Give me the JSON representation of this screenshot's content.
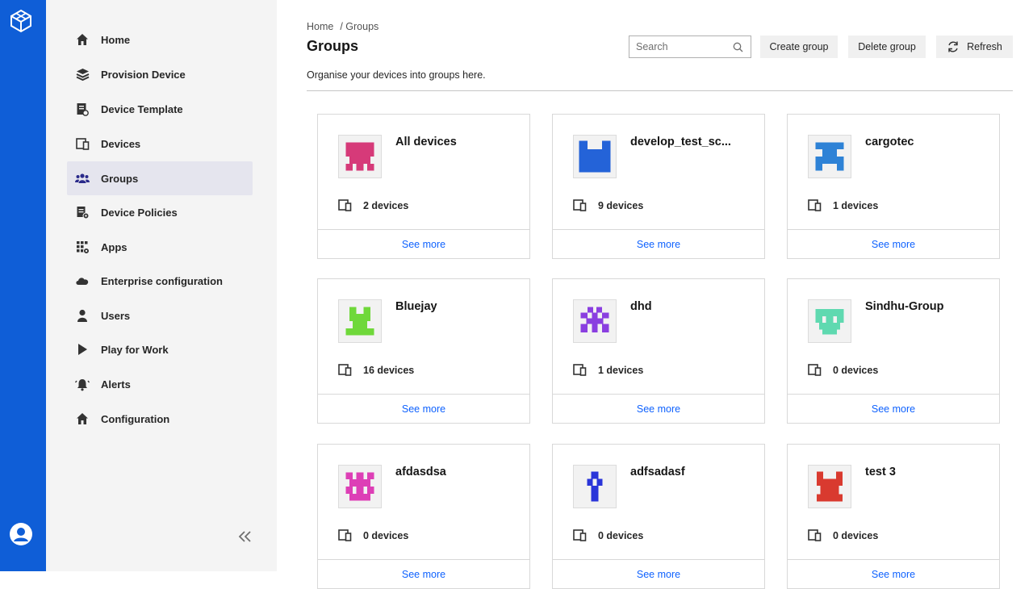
{
  "sidebar": {
    "items": [
      {
        "label": "Home",
        "icon": "home-icon"
      },
      {
        "label": "Provision Device",
        "icon": "layers-icon"
      },
      {
        "label": "Device Template",
        "icon": "template-icon"
      },
      {
        "label": "Devices",
        "icon": "devices-icon"
      },
      {
        "label": "Groups",
        "icon": "groups-icon"
      },
      {
        "label": "Device Policies",
        "icon": "policy-icon"
      },
      {
        "label": "Apps",
        "icon": "apps-icon"
      },
      {
        "label": "Enterprise configuration",
        "icon": "cloud-icon"
      },
      {
        "label": "Users",
        "icon": "user-icon"
      },
      {
        "label": "Play for Work",
        "icon": "play-icon"
      },
      {
        "label": "Alerts",
        "icon": "alert-icon"
      },
      {
        "label": "Configuration",
        "icon": "home-icon"
      }
    ],
    "active": "Groups"
  },
  "breadcrumb": {
    "home": "Home",
    "current": "/ Groups"
  },
  "page": {
    "title": "Groups",
    "subtitle": "Organise your devices into groups here."
  },
  "toolbar": {
    "search_placeholder": "Search",
    "create_label": "Create group",
    "delete_label": "Delete group",
    "refresh_label": "Refresh"
  },
  "colors": {
    "rail": "#0f5ed7",
    "link": "#0f62fe"
  },
  "groups": [
    {
      "name": "All devices",
      "devices": "2 devices",
      "more": "See more",
      "color": "#d63a79"
    },
    {
      "name": "develop_test_sc...",
      "devices": "9 devices",
      "more": "See more",
      "color": "#2463d8"
    },
    {
      "name": "cargotec",
      "devices": "1 devices",
      "more": "See more",
      "color": "#2e82d6"
    },
    {
      "name": "Bluejay",
      "devices": "16 devices",
      "more": "See more",
      "color": "#6fd83a"
    },
    {
      "name": "dhd",
      "devices": "1 devices",
      "more": "See more",
      "color": "#8a3fe0"
    },
    {
      "name": "Sindhu-Group",
      "devices": "0 devices",
      "more": "See more",
      "color": "#5fd9b0"
    },
    {
      "name": "afdasdsa",
      "devices": "0 devices",
      "more": "See more",
      "color": "#dd3fb6"
    },
    {
      "name": "adfsadasf",
      "devices": "0 devices",
      "more": "See more",
      "color": "#2a35d9"
    },
    {
      "name": "test 3",
      "devices": "0 devices",
      "more": "See more",
      "color": "#d93a2f"
    }
  ]
}
